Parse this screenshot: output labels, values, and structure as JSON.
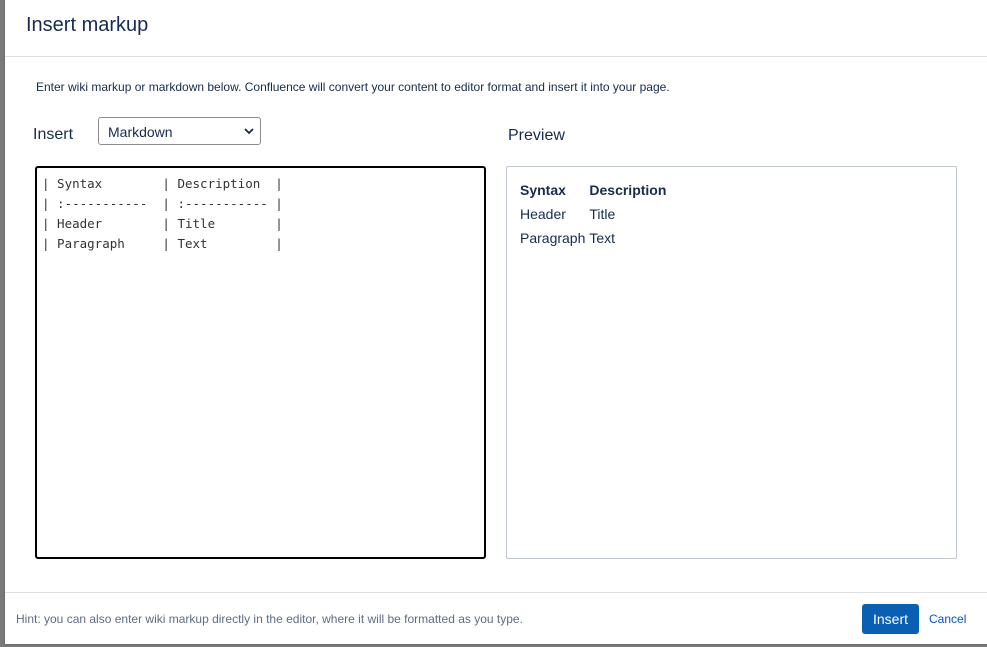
{
  "dialog": {
    "title": "Insert markup",
    "description": "Enter wiki markup or markdown below. Confluence will convert your content to editor format and insert it into your page."
  },
  "insert": {
    "label": "Insert",
    "format_select": {
      "selected": "Markdown",
      "icon": "chevron-down-icon"
    }
  },
  "editor": {
    "lines": [
      "| Syntax        | Description  |",
      "| :-----------  | :----------- |",
      "| Header        | Title        |",
      "| Paragraph     | Text         |"
    ]
  },
  "preview": {
    "label": "Preview",
    "headers": [
      "Syntax",
      "Description"
    ],
    "rows": [
      [
        "Header",
        "Title"
      ],
      [
        "Paragraph",
        "Text"
      ]
    ]
  },
  "footer": {
    "hint": "Hint: you can also enter wiki markup directly in the editor, where it will be formatted as you type.",
    "insert_label": "Insert",
    "cancel_label": "Cancel"
  },
  "colors": {
    "primary_button": "#0b5fb3",
    "link": "#0052cc",
    "text": "#172b4d"
  }
}
